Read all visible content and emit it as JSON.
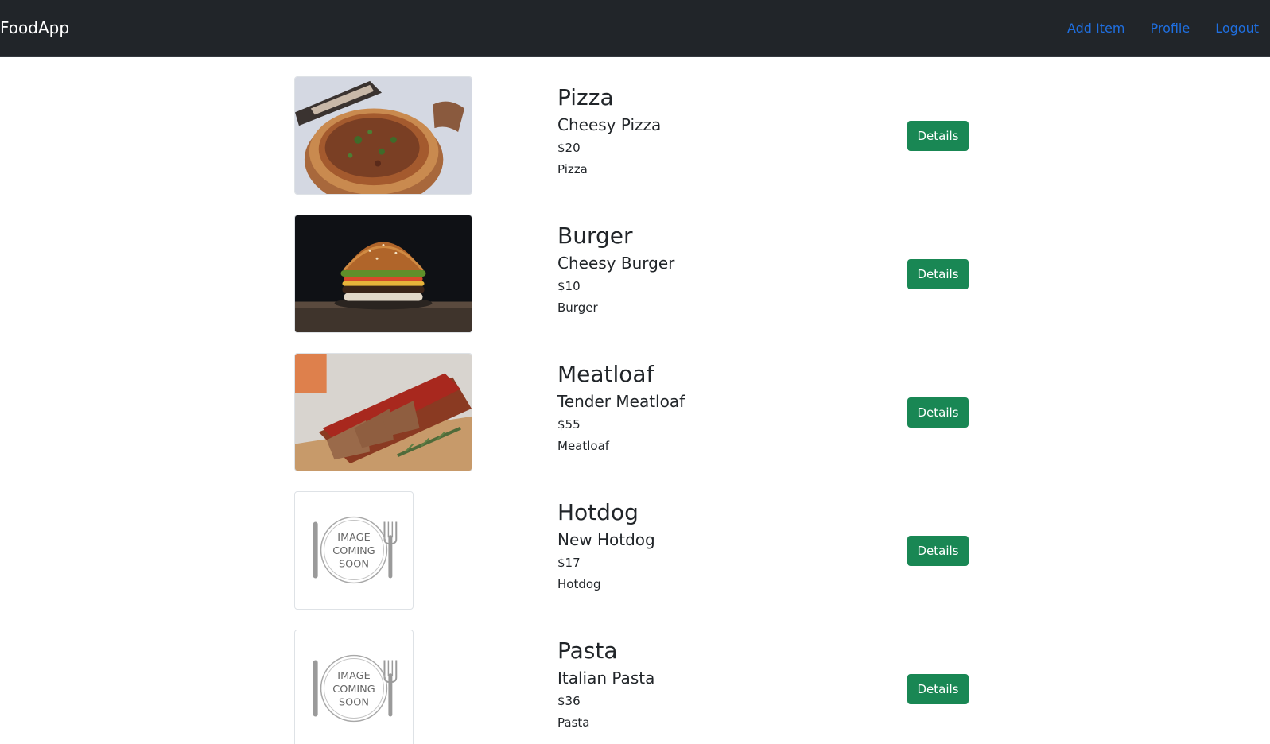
{
  "navbar": {
    "brand": "FoodApp",
    "links": [
      {
        "label": "Add Item"
      },
      {
        "label": "Profile"
      },
      {
        "label": "Logout"
      }
    ]
  },
  "placeholder_text": [
    "IMAGE",
    "COMING",
    "SOON"
  ],
  "items": [
    {
      "name": "Pizza",
      "description": "Cheesy Pizza",
      "price": "$20",
      "category": "Pizza",
      "image": "pizza-photo",
      "button": "Details"
    },
    {
      "name": "Burger",
      "description": "Cheesy Burger",
      "price": "$10",
      "category": "Burger",
      "image": "burger-photo",
      "button": "Details"
    },
    {
      "name": "Meatloaf",
      "description": "Tender Meatloaf",
      "price": "$55",
      "category": "Meatloaf",
      "image": "meatloaf-photo",
      "button": "Details"
    },
    {
      "name": "Hotdog",
      "description": "New Hotdog",
      "price": "$17",
      "category": "Hotdog",
      "image": "image-coming-soon-placeholder",
      "button": "Details"
    },
    {
      "name": "Pasta",
      "description": "Italian Pasta",
      "price": "$36",
      "category": "Pasta",
      "image": "image-coming-soon-placeholder",
      "button": "Details"
    }
  ],
  "colors": {
    "navbar_bg": "#212529",
    "link": "#1f6fe0",
    "button_bg": "#198754",
    "text": "#212529"
  }
}
